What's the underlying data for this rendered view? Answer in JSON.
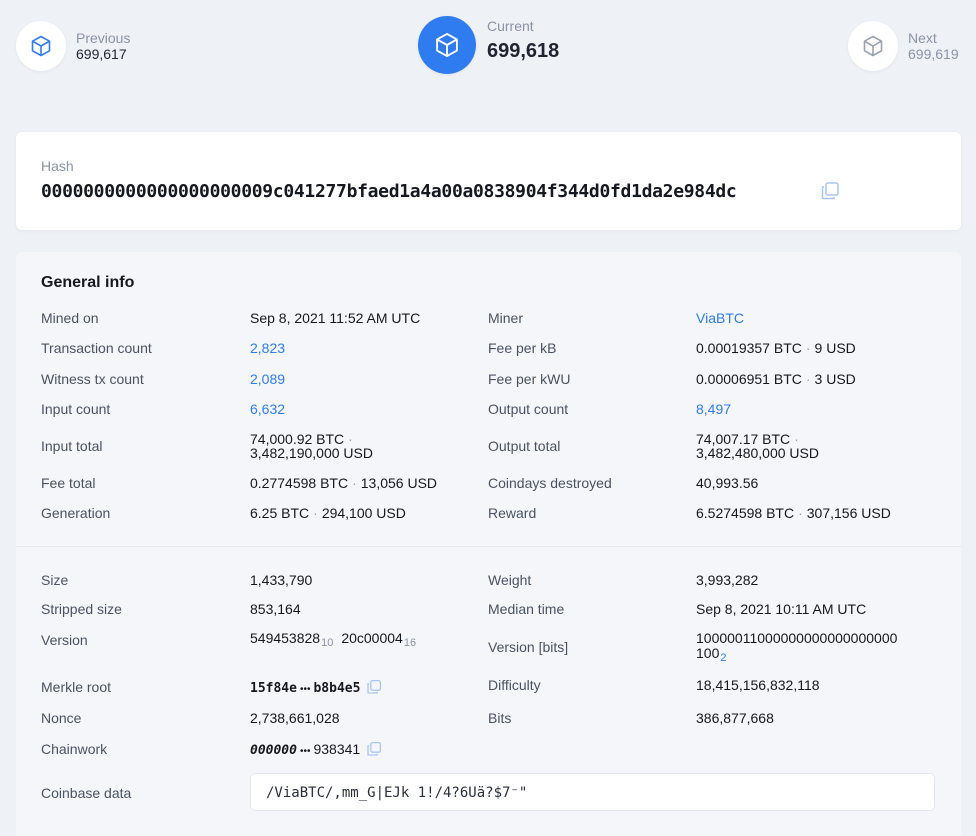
{
  "nav": {
    "previous": {
      "label": "Previous",
      "number": "699,617"
    },
    "current": {
      "label": "Current",
      "number": "699,618"
    },
    "next": {
      "label": "Next",
      "number": "699,619"
    }
  },
  "hash": {
    "label": "Hash",
    "value": "0000000000000000000009c041277bfaed1a4a00a0838904f344d0fd1da2e984dc"
  },
  "general": {
    "title": "General info",
    "mined_on": {
      "label": "Mined on",
      "value": "Sep 8, 2021 11:52 AM UTC"
    },
    "miner": {
      "label": "Miner",
      "value": "ViaBTC"
    },
    "tx_count": {
      "label": "Transaction count",
      "value": "2,823"
    },
    "fee_per_kb": {
      "label": "Fee per kB",
      "btc": "0.00019357 BTC",
      "usd": "9 USD"
    },
    "witness_count": {
      "label": "Witness tx count",
      "value": "2,089"
    },
    "fee_per_kwu": {
      "label": "Fee per kWU",
      "btc": "0.00006951 BTC",
      "usd": "3 USD"
    },
    "input_count": {
      "label": "Input count",
      "value": "6,632"
    },
    "output_count": {
      "label": "Output count",
      "value": "8,497"
    },
    "input_total": {
      "label": "Input total",
      "btc": "74,000.92 BTC",
      "usd": "3,482,190,000 USD"
    },
    "output_total": {
      "label": "Output total",
      "btc": "74,007.17 BTC",
      "usd": "3,482,480,000 USD"
    },
    "fee_total": {
      "label": "Fee total",
      "btc": "0.2774598 BTC",
      "usd": "13,056 USD"
    },
    "coindays": {
      "label": "Coindays destroyed",
      "value": "40,993.56"
    },
    "generation": {
      "label": "Generation",
      "btc": "6.25 BTC",
      "usd": "294,100 USD"
    },
    "reward": {
      "label": "Reward",
      "btc": "6.5274598 BTC",
      "usd": "307,156 USD"
    },
    "dot": "·"
  },
  "details": {
    "size": {
      "label": "Size",
      "value": "1,433,790"
    },
    "weight": {
      "label": "Weight",
      "value": "3,993,282"
    },
    "stripped": {
      "label": "Stripped size",
      "value": "853,164"
    },
    "median": {
      "label": "Median time",
      "value": "Sep 8, 2021 10:11 AM UTC"
    },
    "version": {
      "label": "Version",
      "dec": "549453828",
      "dec_base": "10",
      "hex": "20c00004",
      "hex_base": "16"
    },
    "version_bits": {
      "label": "Version [bits]",
      "line1": "10000011000000000000000000",
      "line2": "100",
      "base": "2"
    },
    "merkle": {
      "label": "Merkle root",
      "start": "15f84e",
      "end": "b8b4e5"
    },
    "difficulty": {
      "label": "Difficulty",
      "value": "18,415,156,832,118"
    },
    "nonce": {
      "label": "Nonce",
      "value": "2,738,661,028"
    },
    "bits": {
      "label": "Bits",
      "value": "386,877,668"
    },
    "chainwork": {
      "label": "Chainwork",
      "start": "000000",
      "end": "938341"
    },
    "ellipsis": "•••",
    "coinbase": {
      "label": "Coinbase data",
      "value": "/ViaBTC/,mm_G|EJk 1!/4?6Uä?$7⁻\""
    }
  },
  "colors": {
    "accent": "#2f7cf0",
    "background": "#eef1f6",
    "card": "#ffffff"
  },
  "icons": {
    "block": "cube-icon",
    "copy": "copy-icon"
  }
}
